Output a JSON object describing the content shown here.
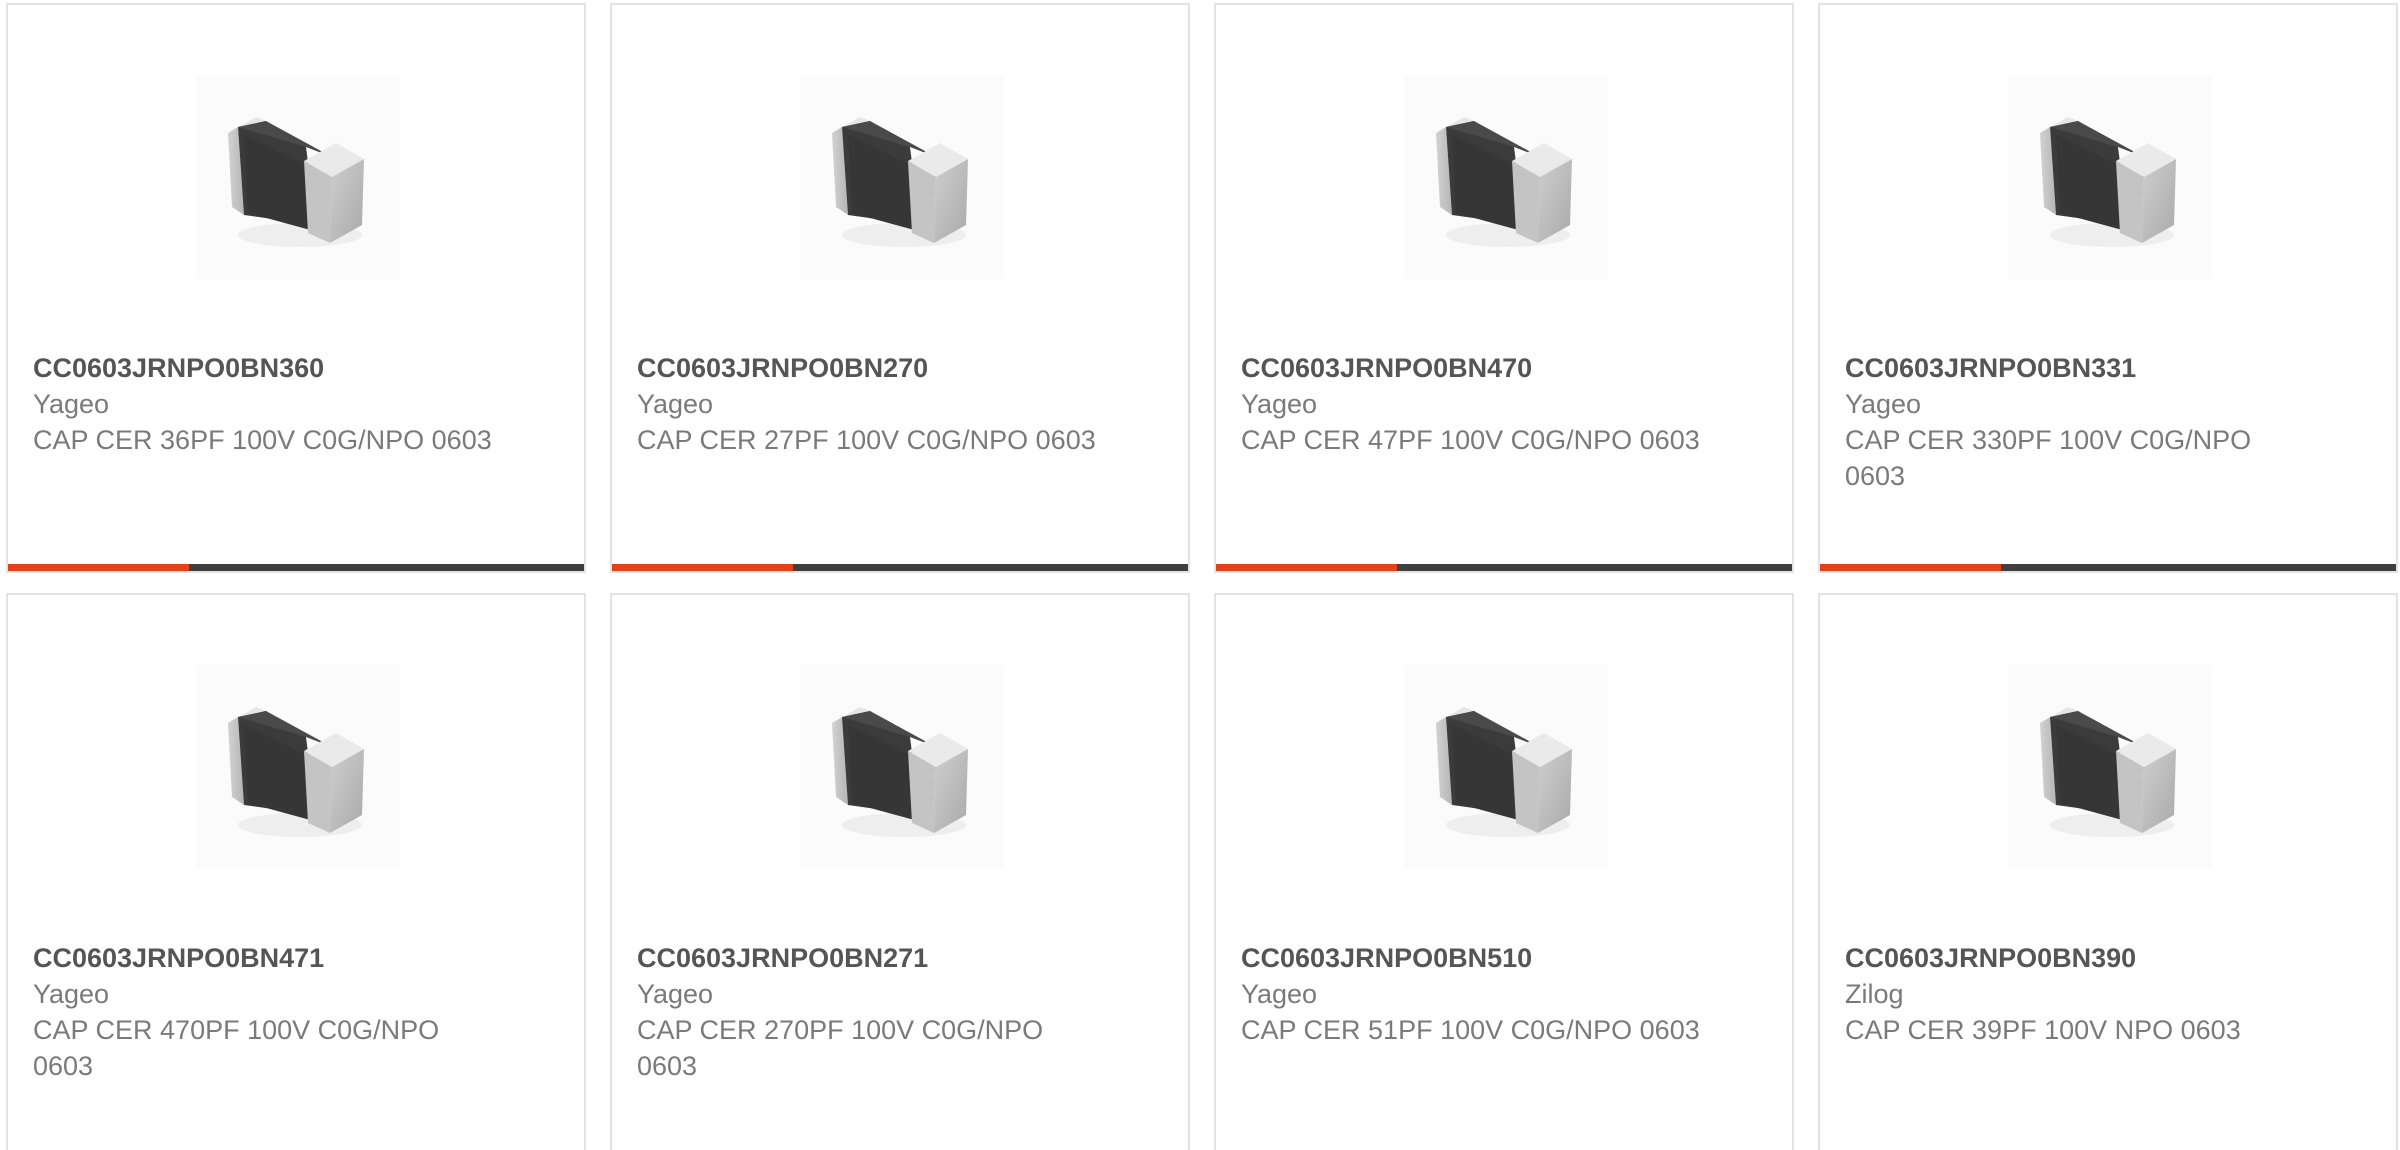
{
  "colors": {
    "accent": "#e3411a",
    "bar_track": "#3f3f3f",
    "card_border": "#e2e2e2",
    "text": "#7a7a7a",
    "title": "#555555"
  },
  "products": [
    {
      "part": "CC0603JRNPO0BN360",
      "manufacturer": "Yageo",
      "description": "CAP CER 36PF 100V C0G/NPO 0603",
      "image_icon": "smd-capacitor-icon",
      "progress": 0.315
    },
    {
      "part": "CC0603JRNPO0BN270",
      "manufacturer": "Yageo",
      "description": "CAP CER 27PF 100V C0G/NPO 0603",
      "image_icon": "smd-capacitor-icon",
      "progress": 0.315
    },
    {
      "part": "CC0603JRNPO0BN470",
      "manufacturer": "Yageo",
      "description": "CAP CER 47PF 100V C0G/NPO 0603",
      "image_icon": "smd-capacitor-icon",
      "progress": 0.315
    },
    {
      "part": "CC0603JRNPO0BN331",
      "manufacturer": "Yageo",
      "description": "CAP CER 330PF 100V C0G/NPO 0603",
      "image_icon": "smd-capacitor-icon",
      "progress": 0.315
    },
    {
      "part": "CC0603JRNPO0BN471",
      "manufacturer": "Yageo",
      "description": "CAP CER 470PF 100V C0G/NPO 0603",
      "image_icon": "smd-capacitor-icon"
    },
    {
      "part": "CC0603JRNPO0BN271",
      "manufacturer": "Yageo",
      "description": "CAP CER 270PF 100V C0G/NPO 0603",
      "image_icon": "smd-capacitor-icon"
    },
    {
      "part": "CC0603JRNPO0BN510",
      "manufacturer": "Yageo",
      "description": "CAP CER 51PF 100V C0G/NPO 0603",
      "image_icon": "smd-capacitor-icon"
    },
    {
      "part": "CC0603JRNPO0BN390",
      "manufacturer": "Zilog",
      "description": "CAP CER 39PF 100V NPO 0603",
      "image_icon": "smd-capacitor-icon"
    }
  ]
}
